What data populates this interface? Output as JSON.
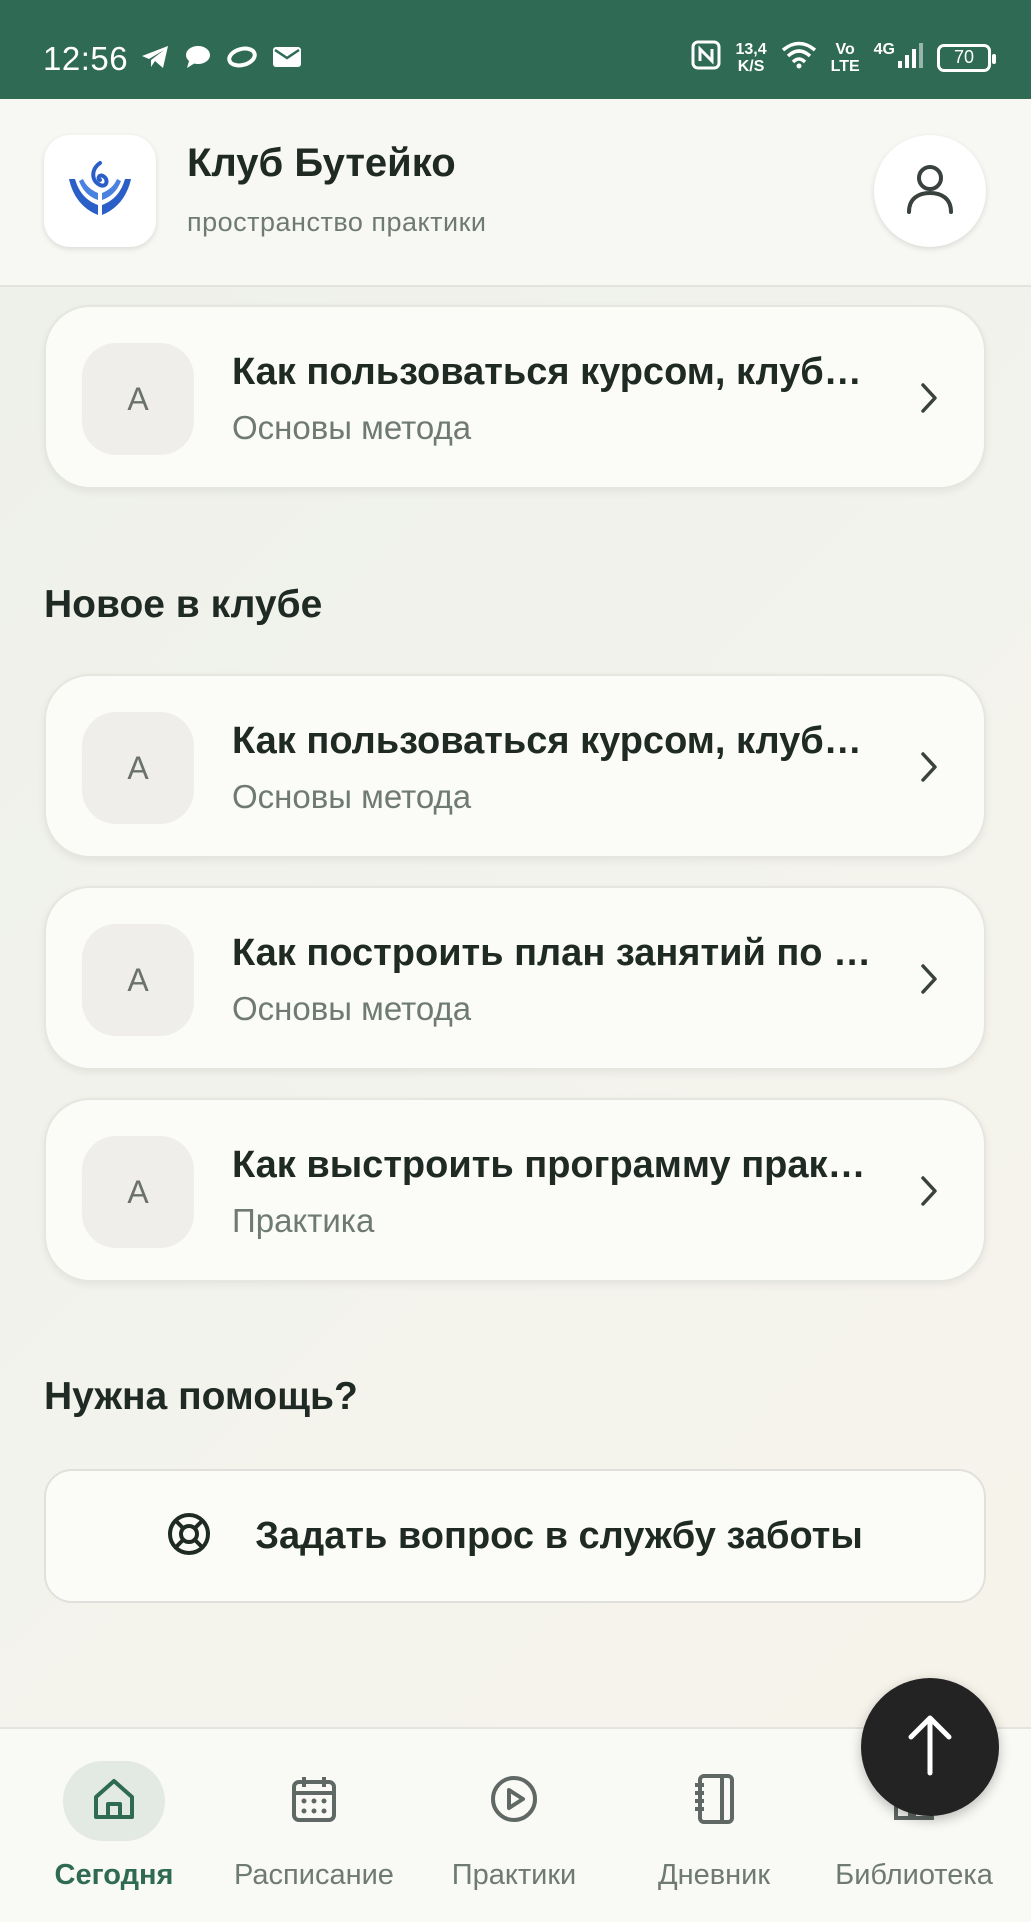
{
  "status_bar": {
    "time": "12:56",
    "speed_value": "13,4",
    "speed_unit": "K/S",
    "volte_top": "Vo",
    "volte_bottom": "LTE",
    "network": "4G",
    "battery": "70",
    "icons": [
      "telegram-icon",
      "chat-bubble-icon",
      "oval-icon",
      "mail-icon",
      "nfc-icon",
      "wifi-icon",
      "signal-icon",
      "battery-icon"
    ]
  },
  "header": {
    "title": "Клуб Бутейко",
    "subtitle": "пространство практики",
    "logo_icon": "hands-breath-logo",
    "profile_icon": "user-icon",
    "logo_color": "#2a5fc7"
  },
  "top_card": {
    "avatar": "А",
    "title": "Как пользоваться курсом, клуб…",
    "subtitle": "Основы метода"
  },
  "new_section": {
    "title": "Новое в клубе",
    "items": [
      {
        "avatar": "А",
        "title": "Как пользоваться курсом, клуб…",
        "subtitle": "Основы метода"
      },
      {
        "avatar": "А",
        "title": "Как построить план занятий по …",
        "subtitle": "Основы метода"
      },
      {
        "avatar": "А",
        "title": "Как выстроить программу прак…",
        "subtitle": "Практика"
      }
    ]
  },
  "help": {
    "title": "Нужна помощь?",
    "button_label": "Задать вопрос в службу заботы",
    "button_icon": "lifebuoy-icon"
  },
  "bottom_nav": {
    "items": [
      {
        "label": "Сегодня",
        "icon": "home-icon",
        "active": true
      },
      {
        "label": "Расписание",
        "icon": "calendar-icon",
        "active": false
      },
      {
        "label": "Практики",
        "icon": "play-circle-icon",
        "active": false
      },
      {
        "label": "Дневник",
        "icon": "notebook-icon",
        "active": false
      },
      {
        "label": "Библиотека",
        "icon": "library-icon",
        "active": false
      }
    ]
  },
  "fab_icon": "arrow-up-icon",
  "colors": {
    "status_bar": "#2f6a55",
    "accent": "#2f6a55",
    "text": "#1f2a24",
    "muted": "#6f7a74"
  }
}
